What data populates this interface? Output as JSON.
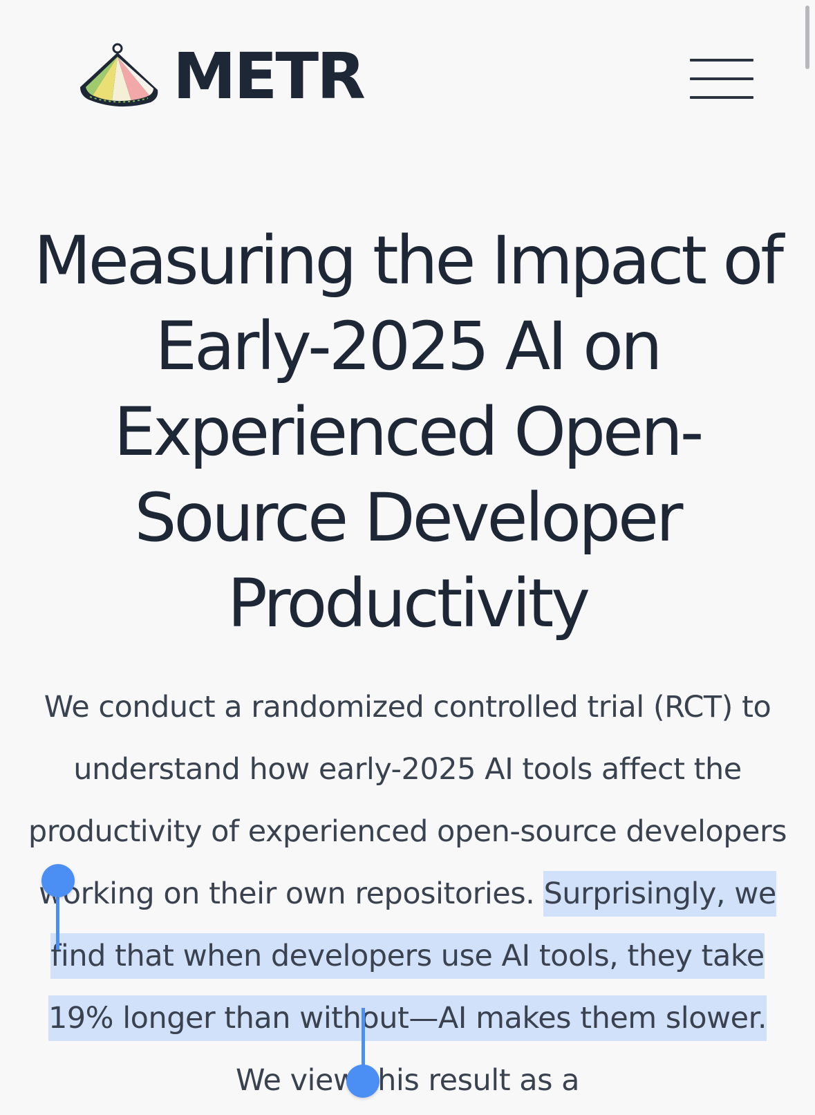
{
  "header": {
    "brand": "METR",
    "logo_icon": "metr-logo-icon",
    "menu_icon": "hamburger-menu-icon"
  },
  "article": {
    "title": "Measuring the Impact of Early-2025 AI on Experienced Open-Source Developer Productivity",
    "abstract_before": "We conduct a randomized controlled trial (RCT) to understand how early-2025 AI tools affect the productivity of experienced open-source developers working on their own repositories. ",
    "abstract_selected": "Surprisingly, we find that when developers use AI tools, they take 19% longer than without—AI makes them slower.",
    "abstract_after": " We view this result as a"
  },
  "selection": {
    "highlight_color": "#afcdfa",
    "handle_color": "#4b8ff5"
  },
  "colors": {
    "background": "#f8f8f9",
    "text_dark": "#1e2735",
    "text_body": "#3a4250"
  }
}
